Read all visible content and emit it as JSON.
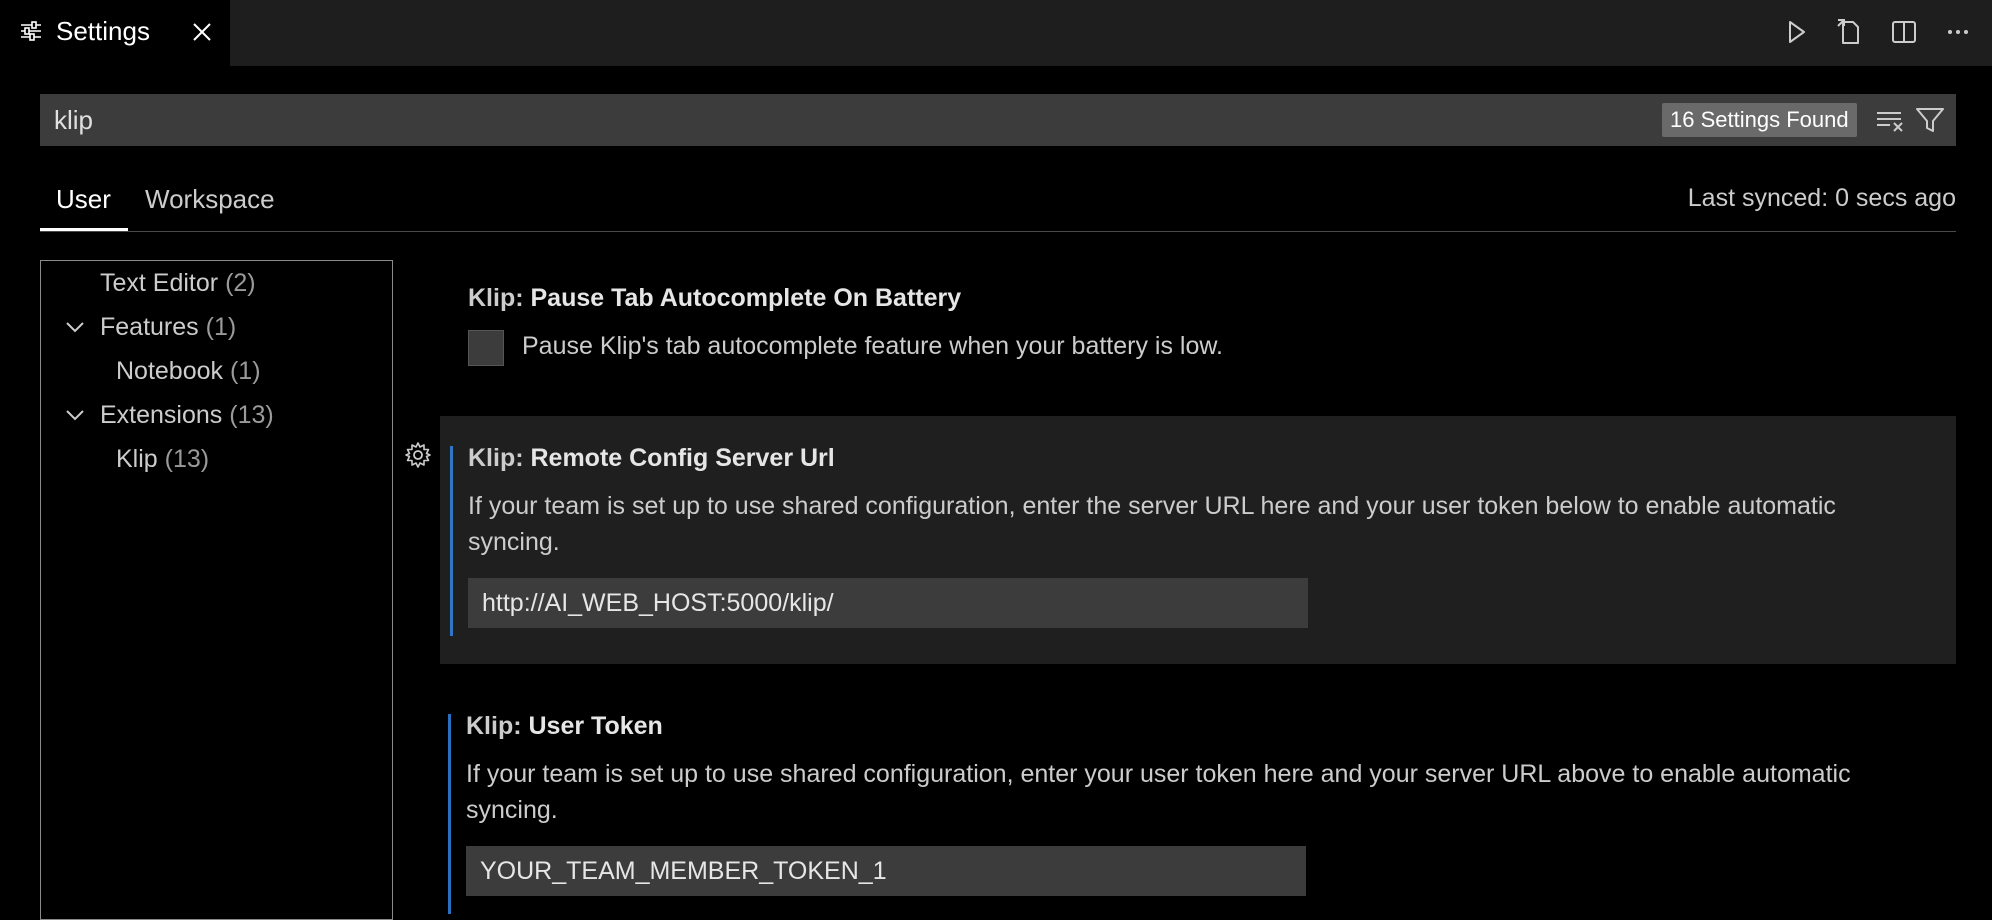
{
  "tab": {
    "icon": "settings-sliders-icon",
    "label": "Settings",
    "close_icon": "close-icon"
  },
  "editor_actions": [
    {
      "name": "run-icon"
    },
    {
      "name": "open-json-icon"
    },
    {
      "name": "split-editor-icon"
    },
    {
      "name": "more-actions-icon"
    }
  ],
  "search": {
    "value": "klip",
    "results_badge": "16 Settings Found"
  },
  "scope": {
    "user": "User",
    "workspace": "Workspace",
    "last_synced": "Last synced: 0 secs ago"
  },
  "toc": [
    {
      "label": "Text Editor",
      "count": "(2)"
    },
    {
      "label": "Features",
      "count": "(1)"
    },
    {
      "label": "Notebook",
      "count": "(1)"
    },
    {
      "label": "Extensions",
      "count": "(13)"
    },
    {
      "label": "Klip",
      "count": "(13)"
    }
  ],
  "settings": [
    {
      "category": "Klip: ",
      "title": "Pause Tab Autocomplete On Battery",
      "description": "Pause Klip's tab autocomplete feature when your battery is low."
    },
    {
      "category": "Klip: ",
      "title": "Remote Config Server Url",
      "description": "If your team is set up to use shared configuration, enter the server URL here and your user token below to enable automatic syncing.",
      "value": "http://AI_WEB_HOST:5000/klip/"
    },
    {
      "category": "Klip: ",
      "title": "User Token",
      "description": "If your team is set up to use shared configuration, enter your user token here and your server URL above to enable automatic syncing.",
      "value": "YOUR_TEAM_MEMBER_TOKEN_1"
    }
  ],
  "colors": {
    "focus_indicator": "#3794ff",
    "input_bg": "#3c3c3c",
    "background": "#000000"
  }
}
